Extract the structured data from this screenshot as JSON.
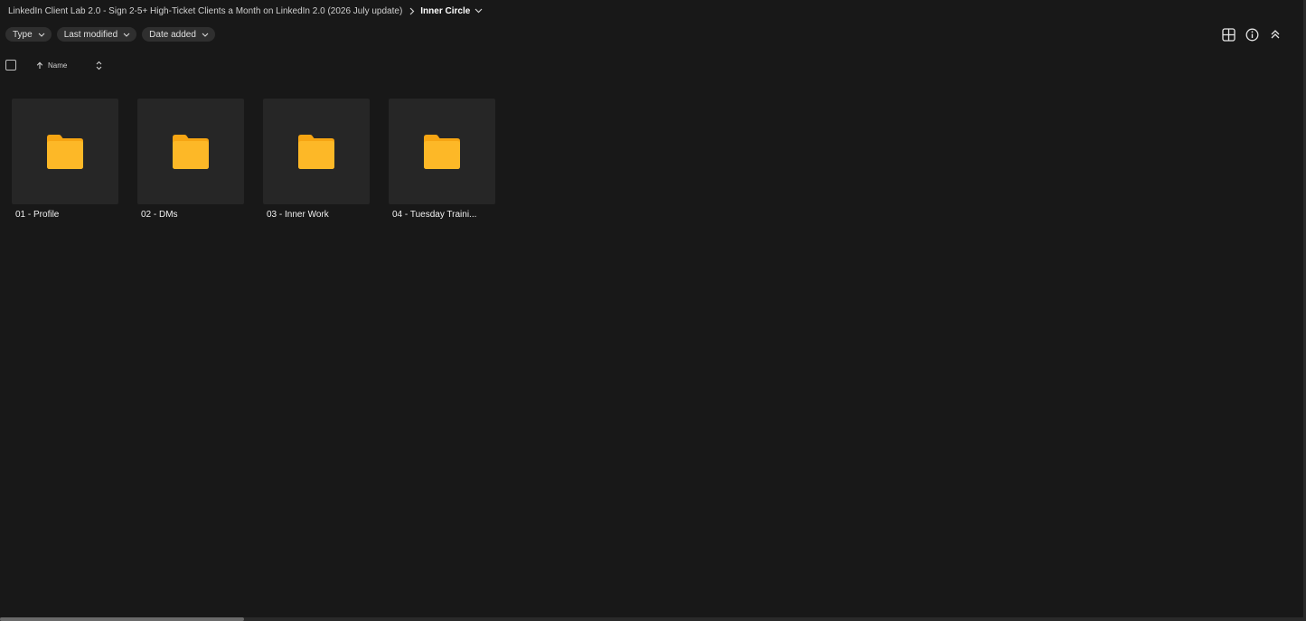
{
  "breadcrumb": {
    "parent": "LinkedIn Client Lab 2.0 - Sign 2-5+ High-Ticket Clients a Month on LinkedIn 2.0 (2026 July update)",
    "current": "Inner Circle",
    "separator_icon": "chevron-right-icon",
    "dropdown_icon": "chevron-down-icon"
  },
  "filters": [
    {
      "label": "Type"
    },
    {
      "label": "Last modified"
    },
    {
      "label": "Date added"
    }
  ],
  "toolbar": {
    "icons": [
      "grid-view-icon",
      "info-icon",
      "collapse-up-icon"
    ]
  },
  "list_header": {
    "name_label": "Name",
    "sort_icon": "arrow-up-icon",
    "toggle_icon": "sort-toggle-icon"
  },
  "folders": [
    {
      "name": "01 - Profile",
      "icon": "folder-icon"
    },
    {
      "name": "02 - DMs",
      "icon": "folder-icon"
    },
    {
      "name": "03 - Inner Work",
      "icon": "folder-icon"
    },
    {
      "name": "04 - Tuesday Traini...",
      "icon": "folder-icon"
    }
  ],
  "colors": {
    "background": "#181818",
    "card": "#262626",
    "chip": "#2f2f2f",
    "folder": "#fbb116"
  },
  "scroll": {
    "horizontal_position": 0.0
  }
}
